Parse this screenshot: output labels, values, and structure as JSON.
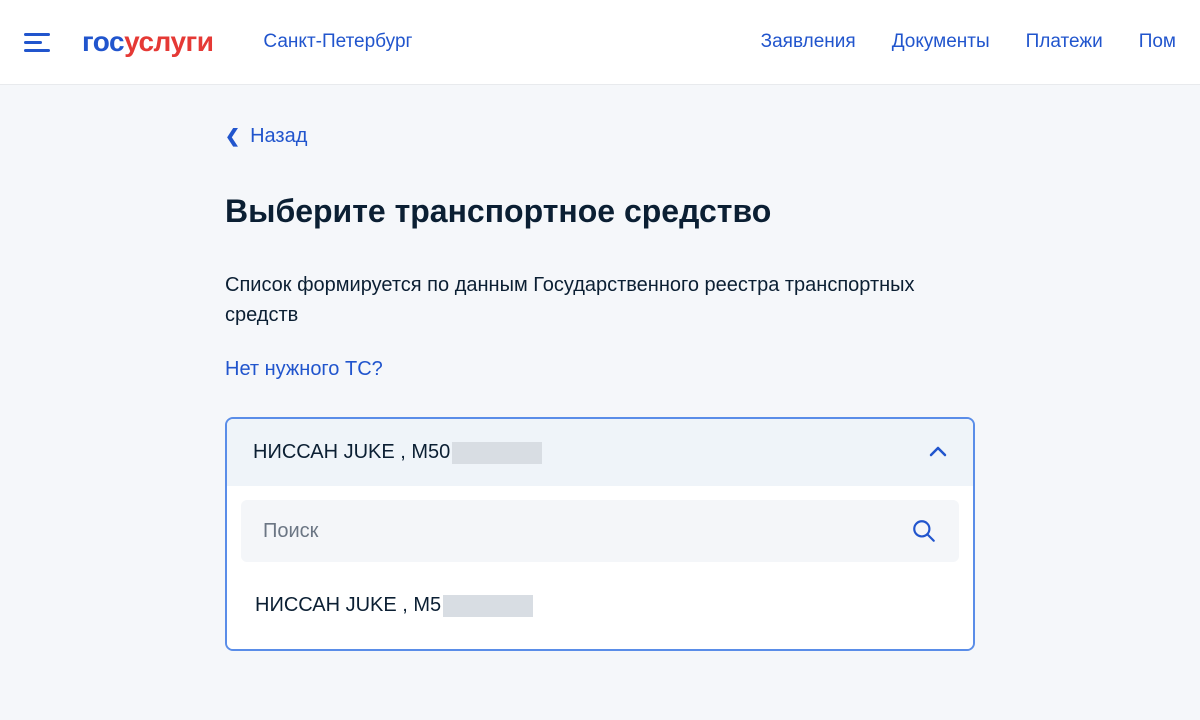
{
  "header": {
    "logo_gos": "гос",
    "logo_uslugi": "услуги",
    "city": "Санкт-Петербург",
    "nav": {
      "applications": "Заявления",
      "documents": "Документы",
      "payments": "Платежи",
      "help": "Пом"
    }
  },
  "main": {
    "back_label": "Назад",
    "title": "Выберите транспортное средство",
    "description": "Список формируется по данным Государственного реестра транспортных средств",
    "help_link": "Нет нужного ТС?",
    "dropdown": {
      "selected_prefix": "НИССАН JUKE , М50",
      "search_placeholder": "Поиск",
      "option_prefix": "НИССАН JUKE , М5"
    }
  }
}
